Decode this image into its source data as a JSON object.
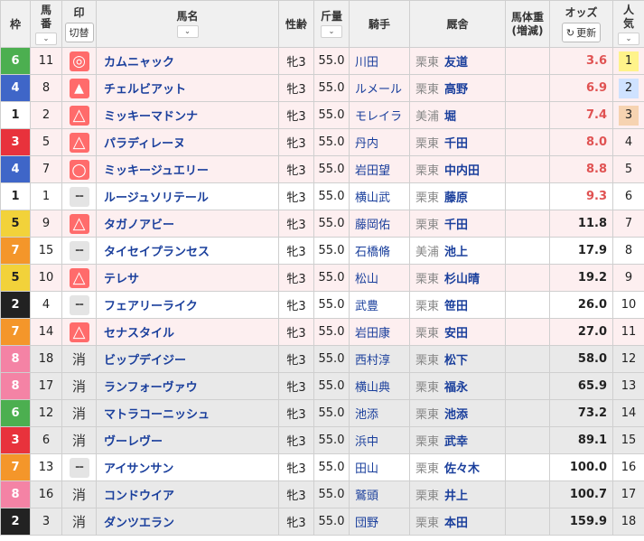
{
  "headers": {
    "waku": "枠",
    "uma_top": "馬",
    "uma_bottom": "番",
    "mark": "印",
    "mark_toggle": "切替",
    "horse": "馬名",
    "sexage": "性齢",
    "kinryo": "斤量",
    "jockey": "騎手",
    "stable": "厩舎",
    "weight_top": "馬体重",
    "weight_bottom": "(増減)",
    "odds": "オッズ",
    "refresh": "更新",
    "pop_top": "人",
    "pop_bottom": "気",
    "sort_glyph": "⌄"
  },
  "colors": {
    "waku": {
      "1": {
        "bg": "#ffffff",
        "fg": "#222222"
      },
      "2": {
        "bg": "#222222",
        "fg": "#ffffff"
      },
      "3": {
        "bg": "#e8323c",
        "fg": "#ffffff"
      },
      "4": {
        "bg": "#3f66c8",
        "fg": "#ffffff"
      },
      "5": {
        "bg": "#f2d23a",
        "fg": "#222222"
      },
      "6": {
        "bg": "#4caf50",
        "fg": "#ffffff"
      },
      "7": {
        "bg": "#f4962a",
        "fg": "#ffffff"
      },
      "8": {
        "bg": "#f483a5",
        "fg": "#ffffff"
      }
    },
    "pop": {
      "1": "#fff38a",
      "2": "#cfe2ff",
      "3": "#f6d3b1"
    }
  },
  "mark_glyphs": {
    "dbl": "◎",
    "tri-fill": "▲",
    "tri": "△",
    "circ": "○",
    "dash": "--",
    "kesu": "消"
  },
  "rows": [
    {
      "waku": "6",
      "uma": "11",
      "mark": "dbl",
      "name": "カムニャック",
      "sex": "牝3",
      "kin": "55.0",
      "jockey": "川田",
      "loc": "栗東",
      "trainer": "友道",
      "odds": "3.6",
      "hot": true,
      "pop": "1",
      "tone": "pink"
    },
    {
      "waku": "4",
      "uma": "8",
      "mark": "tri-fill",
      "name": "チェルビアット",
      "sex": "牝3",
      "kin": "55.0",
      "jockey": "ルメール",
      "loc": "栗東",
      "trainer": "高野",
      "odds": "6.9",
      "hot": true,
      "pop": "2",
      "tone": "pink"
    },
    {
      "waku": "1",
      "uma": "2",
      "mark": "tri",
      "name": "ミッキーマドンナ",
      "sex": "牝3",
      "kin": "55.0",
      "jockey": "モレイラ",
      "loc": "美浦",
      "trainer": "堀",
      "odds": "7.4",
      "hot": true,
      "pop": "3",
      "tone": "pink"
    },
    {
      "waku": "3",
      "uma": "5",
      "mark": "tri",
      "name": "パラディレーヌ",
      "sex": "牝3",
      "kin": "55.0",
      "jockey": "丹内",
      "loc": "栗東",
      "trainer": "千田",
      "odds": "8.0",
      "hot": true,
      "pop": "4",
      "tone": "pink"
    },
    {
      "waku": "4",
      "uma": "7",
      "mark": "circ",
      "name": "ミッキージュエリー",
      "sex": "牝3",
      "kin": "55.0",
      "jockey": "岩田望",
      "loc": "栗東",
      "trainer": "中内田",
      "odds": "8.8",
      "hot": true,
      "pop": "5",
      "tone": "pink"
    },
    {
      "waku": "1",
      "uma": "1",
      "mark": "dash",
      "name": "ルージュソリテール",
      "sex": "牝3",
      "kin": "55.0",
      "jockey": "横山武",
      "loc": "栗東",
      "trainer": "藤原",
      "odds": "9.3",
      "hot": true,
      "pop": "6",
      "tone": "white"
    },
    {
      "waku": "5",
      "uma": "9",
      "mark": "tri",
      "name": "タガノアビー",
      "sex": "牝3",
      "kin": "55.0",
      "jockey": "藤岡佑",
      "loc": "栗東",
      "trainer": "千田",
      "odds": "11.8",
      "hot": false,
      "pop": "7",
      "tone": "pink"
    },
    {
      "waku": "7",
      "uma": "15",
      "mark": "dash",
      "name": "タイセイプランセス",
      "sex": "牝3",
      "kin": "55.0",
      "jockey": "石橋脩",
      "loc": "美浦",
      "trainer": "池上",
      "odds": "17.9",
      "hot": false,
      "pop": "8",
      "tone": "white"
    },
    {
      "waku": "5",
      "uma": "10",
      "mark": "tri",
      "name": "テレサ",
      "sex": "牝3",
      "kin": "55.0",
      "jockey": "松山",
      "loc": "栗東",
      "trainer": "杉山晴",
      "odds": "19.2",
      "hot": false,
      "pop": "9",
      "tone": "pink"
    },
    {
      "waku": "2",
      "uma": "4",
      "mark": "dash",
      "name": "フェアリーライク",
      "sex": "牝3",
      "kin": "55.0",
      "jockey": "武豊",
      "loc": "栗東",
      "trainer": "笹田",
      "odds": "26.0",
      "hot": false,
      "pop": "10",
      "tone": "white"
    },
    {
      "waku": "7",
      "uma": "14",
      "mark": "tri",
      "name": "セナスタイル",
      "sex": "牝3",
      "kin": "55.0",
      "jockey": "岩田康",
      "loc": "栗東",
      "trainer": "安田",
      "odds": "27.0",
      "hot": false,
      "pop": "11",
      "tone": "pink"
    },
    {
      "waku": "8",
      "uma": "18",
      "mark": "kesu",
      "name": "ビップデイジー",
      "sex": "牝3",
      "kin": "55.0",
      "jockey": "西村淳",
      "loc": "栗東",
      "trainer": "松下",
      "odds": "58.0",
      "hot": false,
      "pop": "12",
      "tone": "gray"
    },
    {
      "waku": "8",
      "uma": "17",
      "mark": "kesu",
      "name": "ランフォーヴァウ",
      "sex": "牝3",
      "kin": "55.0",
      "jockey": "横山典",
      "loc": "栗東",
      "trainer": "福永",
      "odds": "65.9",
      "hot": false,
      "pop": "13",
      "tone": "gray"
    },
    {
      "waku": "6",
      "uma": "12",
      "mark": "kesu",
      "name": "マトラコーニッシュ",
      "sex": "牝3",
      "kin": "55.0",
      "jockey": "池添",
      "loc": "栗東",
      "trainer": "池添",
      "odds": "73.2",
      "hot": false,
      "pop": "14",
      "tone": "gray"
    },
    {
      "waku": "3",
      "uma": "6",
      "mark": "kesu",
      "name": "ヴーレヴー",
      "sex": "牝3",
      "kin": "55.0",
      "jockey": "浜中",
      "loc": "栗東",
      "trainer": "武幸",
      "odds": "89.1",
      "hot": false,
      "pop": "15",
      "tone": "gray"
    },
    {
      "waku": "7",
      "uma": "13",
      "mark": "dash",
      "name": "アイサンサン",
      "sex": "牝3",
      "kin": "55.0",
      "jockey": "田山",
      "loc": "栗東",
      "trainer": "佐々木",
      "odds": "100.0",
      "hot": false,
      "pop": "16",
      "tone": "white"
    },
    {
      "waku": "8",
      "uma": "16",
      "mark": "kesu",
      "name": "コンドウイア",
      "sex": "牝3",
      "kin": "55.0",
      "jockey": "鷲頭",
      "loc": "栗東",
      "trainer": "井上",
      "odds": "100.7",
      "hot": false,
      "pop": "17",
      "tone": "gray"
    },
    {
      "waku": "2",
      "uma": "3",
      "mark": "kesu",
      "name": "ダンツエラン",
      "sex": "牝3",
      "kin": "55.0",
      "jockey": "団野",
      "loc": "栗東",
      "trainer": "本田",
      "odds": "159.9",
      "hot": false,
      "pop": "18",
      "tone": "gray"
    }
  ]
}
